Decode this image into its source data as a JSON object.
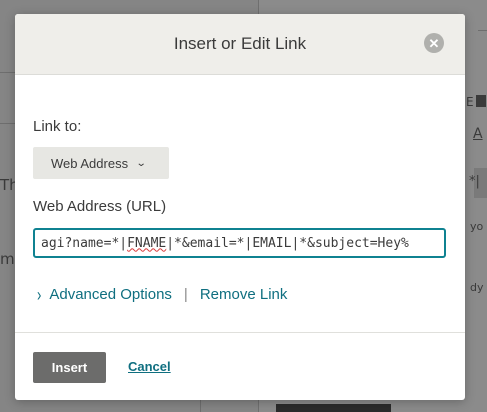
{
  "background": {
    "left_fragments": [
      "Th",
      "m"
    ],
    "right_fragments": [
      "E",
      "A",
      "*|",
      "yo",
      "dy"
    ]
  },
  "dialog": {
    "title": "Insert or Edit Link",
    "close_icon": "close-icon"
  },
  "link_to": {
    "label": "Link to:",
    "selected": "Web Address"
  },
  "url": {
    "label": "Web Address (URL)",
    "value_before": "agi?name=*|",
    "value_spell": "FNAME",
    "value_after": "|*&email=*|EMAIL|*&subject=Hey%"
  },
  "links": {
    "advanced": "Advanced Options",
    "separator": "|",
    "remove": "Remove Link"
  },
  "footer": {
    "insert": "Insert",
    "cancel": "Cancel"
  },
  "colors": {
    "accent": "#0f8291",
    "link": "#0f6f80",
    "insert_button": "#6c6c6b"
  }
}
